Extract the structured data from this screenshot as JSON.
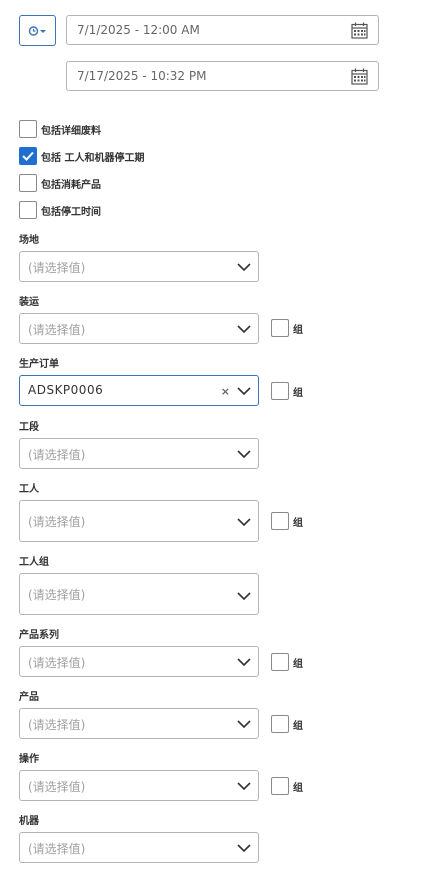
{
  "date_range": {
    "start": "7/1/2025 - 12:00 AM",
    "end": "7/17/2025 - 10:32 PM"
  },
  "options": [
    {
      "label": "包括详细废料",
      "checked": false
    },
    {
      "label": "包括 工人和机器停工期",
      "checked": true
    },
    {
      "label": "包括消耗产品",
      "checked": false
    },
    {
      "label": "包括停工时间",
      "checked": false
    }
  ],
  "placeholder": "(请选择值)",
  "group_label": "组",
  "clear_icon": "×",
  "filters": {
    "site": {
      "label": "场地"
    },
    "shipment": {
      "label": "装运"
    },
    "production_order": {
      "label": "生产订单",
      "value": "ADSKP0006"
    },
    "operation_segment": {
      "label": "工段"
    },
    "worker": {
      "label": "工人"
    },
    "worker_group": {
      "label": "工人组"
    },
    "product_family": {
      "label": "产品系列"
    },
    "product": {
      "label": "产品"
    },
    "operation": {
      "label": "操作"
    },
    "machine": {
      "label": "机器"
    }
  },
  "colors": {
    "accent": "#1f6fd1",
    "border_active": "#3b73b9"
  }
}
